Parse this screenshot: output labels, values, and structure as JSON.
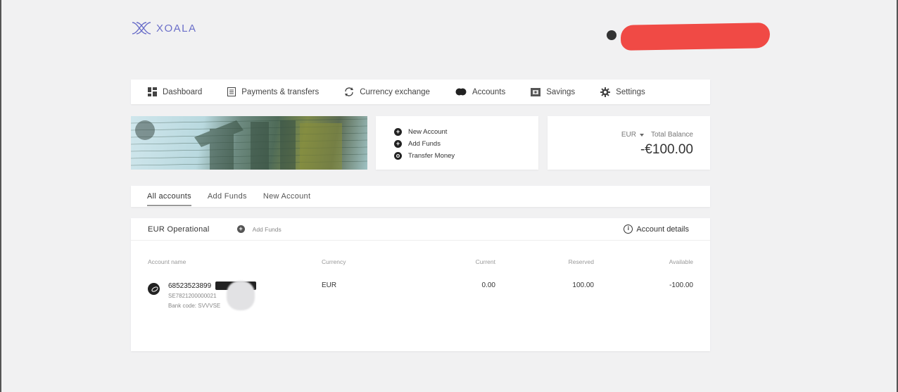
{
  "brand": {
    "name": "XOALA",
    "color": "#6b6fc9"
  },
  "nav": {
    "items": [
      {
        "label": "Dashboard",
        "icon": "dashboard-icon"
      },
      {
        "label": "Payments & transfers",
        "icon": "document-icon"
      },
      {
        "label": "Currency exchange",
        "icon": "exchange-icon"
      },
      {
        "label": "Accounts",
        "icon": "accounts-icon"
      },
      {
        "label": "Savings",
        "icon": "savings-icon"
      },
      {
        "label": "Settings",
        "icon": "gear-icon"
      }
    ]
  },
  "quick_actions": [
    {
      "label": "New Account",
      "icon": "plus-circle-icon"
    },
    {
      "label": "Add Funds",
      "icon": "plus-circle-icon"
    },
    {
      "label": "Transfer Money",
      "icon": "transfer-circle-icon"
    }
  ],
  "balance": {
    "currency": "EUR",
    "label": "Total Balance",
    "amount": "-€100.00"
  },
  "tabs": [
    {
      "label": "All accounts",
      "active": true
    },
    {
      "label": "Add Funds",
      "active": false
    },
    {
      "label": "New Account",
      "active": false
    }
  ],
  "panel": {
    "title": "EUR Operational",
    "add_funds": "Add Funds",
    "details": "Account details",
    "columns": {
      "name": "Account name",
      "currency": "Currency",
      "current": "Current",
      "reserved": "Reserved",
      "available": "Available"
    },
    "row": {
      "number": "68523523899",
      "iban": "SE7821200000021",
      "bank_code": "Bank code: SVVVSE",
      "currency": "EUR",
      "current": "0.00",
      "reserved": "100.00",
      "available": "-100.00"
    }
  }
}
